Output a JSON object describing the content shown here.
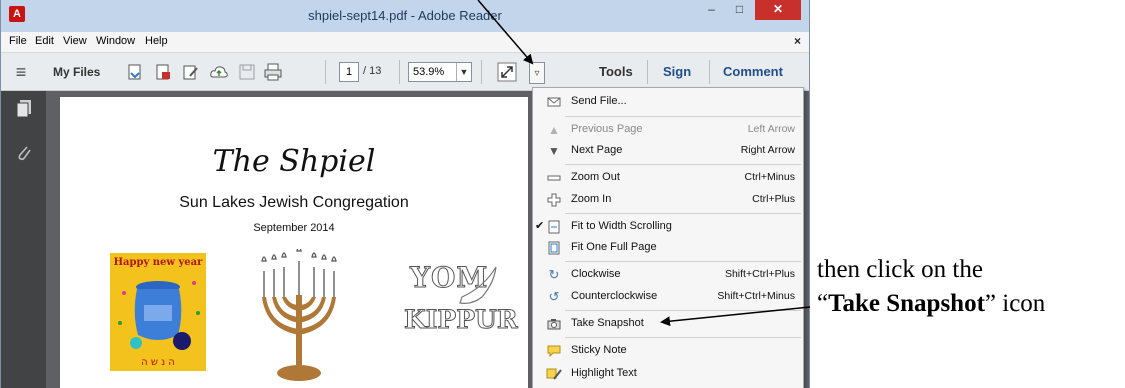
{
  "window": {
    "title": "shpiel-sept14.pdf - Adobe Reader",
    "app_icon": "adobe-reader-icon",
    "minimize": "–",
    "maximize": "□",
    "close": "✕"
  },
  "menubar": {
    "items": [
      "File",
      "Edit",
      "View",
      "Window",
      "Help"
    ],
    "close": "×"
  },
  "toolbar": {
    "my_files": "My Files",
    "page_current": "1",
    "page_total": "/ 13",
    "zoom": "53.9%",
    "tools": "Tools",
    "sign": "Sign",
    "comment": "Comment"
  },
  "document": {
    "title": "The Shpiel",
    "subtitle": "Sun Lakes Jewish Congregation",
    "date": "September 2014",
    "image1_text": "Happy new year",
    "image3_text1": "YOM",
    "image3_text2": "KIPPUR"
  },
  "context_menu": {
    "items": [
      {
        "label": "Send File...",
        "shortcut": "",
        "icon": "envelope-icon",
        "disabled": false
      },
      {
        "label": "Previous Page",
        "shortcut": "Left Arrow",
        "icon": "arrow-up-icon",
        "disabled": true
      },
      {
        "label": "Next Page",
        "shortcut": "Right Arrow",
        "icon": "arrow-down-icon",
        "disabled": false
      },
      {
        "label": "Zoom Out",
        "shortcut": "Ctrl+Minus",
        "icon": "minus-icon",
        "disabled": false
      },
      {
        "label": "Zoom In",
        "shortcut": "Ctrl+Plus",
        "icon": "plus-icon",
        "disabled": false
      },
      {
        "label": "Fit to Width Scrolling",
        "shortcut": "",
        "icon": "fit-width-icon",
        "checked": true,
        "disabled": false
      },
      {
        "label": "Fit One Full Page",
        "shortcut": "",
        "icon": "fit-page-icon",
        "disabled": false
      },
      {
        "label": "Clockwise",
        "shortcut": "Shift+Ctrl+Plus",
        "icon": "rotate-clockwise-icon",
        "disabled": false
      },
      {
        "label": "Counterclockwise",
        "shortcut": "Shift+Ctrl+Minus",
        "icon": "rotate-counterclockwise-icon",
        "disabled": false
      },
      {
        "label": "Take Snapshot",
        "shortcut": "",
        "icon": "camera-icon",
        "disabled": false
      },
      {
        "label": "Sticky Note",
        "shortcut": "",
        "icon": "sticky-note-icon",
        "disabled": false
      },
      {
        "label": "Highlight Text",
        "shortcut": "",
        "icon": "highlighter-icon",
        "disabled": false
      }
    ]
  },
  "annotation": {
    "line1": "then click on the",
    "quote_open": "“",
    "bold": "Take Snapshot",
    "quote_close": "” icon"
  },
  "colors": {
    "titlebar": "#c2d5ea",
    "close_button": "#c7302b",
    "tab_link": "#1e4e8c",
    "doc_background": "#5f6063"
  }
}
